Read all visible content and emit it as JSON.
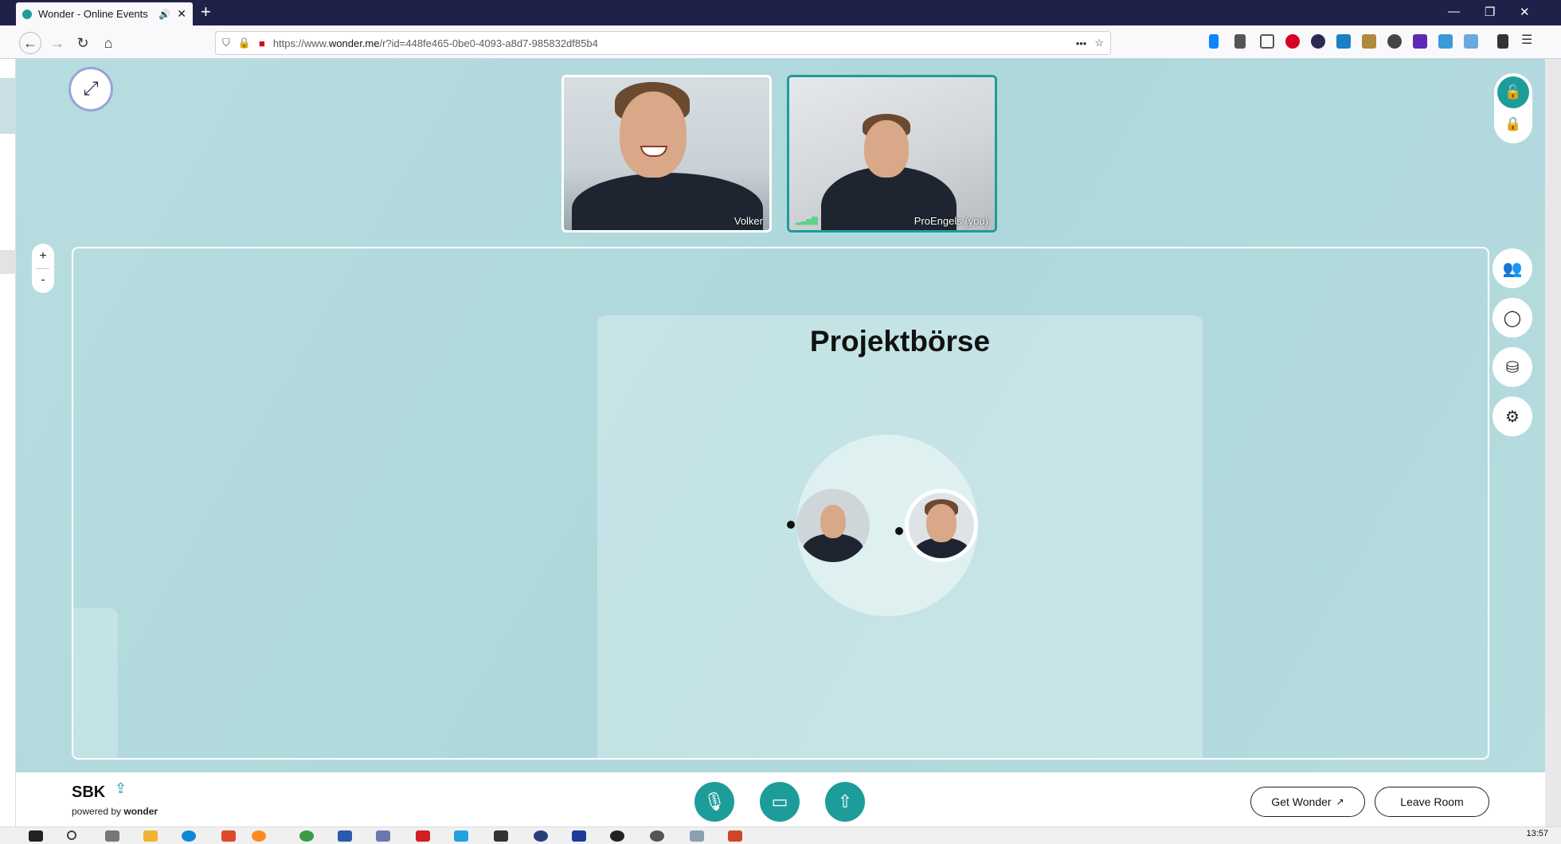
{
  "browser": {
    "tab_title": "Wonder - Online Events",
    "new_tab": "+",
    "url_prefix": "https://www.",
    "url_host": "wonder.me",
    "url_path": "/r?id=448fe465-0be0-4093-a8d7-985832df85b4",
    "window_controls": [
      "—",
      "❐",
      "✕"
    ]
  },
  "videos": [
    {
      "name": "Volker"
    },
    {
      "name": "ProEngels (you)"
    }
  ],
  "zoom": {
    "plus": "+",
    "minus": "-"
  },
  "area": {
    "title": "Projektbörse"
  },
  "bottom": {
    "room_name": "SBK",
    "powered_prefix": "powered by ",
    "powered_brand": "wonder",
    "get_wonder": "Get Wonder",
    "leave_room": "Leave Room"
  },
  "taskbar": {
    "clock": "13:57"
  },
  "colors": {
    "accent": "#1d9d9a",
    "background": "#b0d9dc",
    "browser_dark": "#1f2149"
  },
  "icons": [
    "expand-icon",
    "unlock-icon",
    "lock-icon",
    "people-icon",
    "chat-icon",
    "broadcast-icon",
    "gear-icon",
    "microphone-icon",
    "camera-icon",
    "screen-share-icon",
    "share-icon",
    "external-link-icon"
  ]
}
